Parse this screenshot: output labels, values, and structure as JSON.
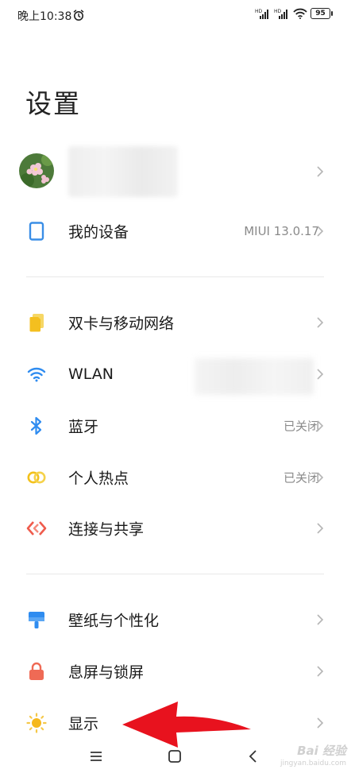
{
  "status_bar": {
    "time": "晚上10:38",
    "signal1": "HD",
    "signal2": "HD",
    "battery": "95"
  },
  "page": {
    "title": "设置"
  },
  "profile": {
    "name": ""
  },
  "items": {
    "my_device": {
      "label": "我的设备",
      "value": "MIUI 13.0.17",
      "icon": "tablet-icon",
      "color": "#3a8ee6"
    },
    "sim": {
      "label": "双卡与移动网络",
      "icon": "sim-card-icon",
      "color": "#f6c02a"
    },
    "wlan": {
      "label": "WLAN",
      "icon": "wifi-icon",
      "color": "#2f8cf0"
    },
    "bluetooth": {
      "label": "蓝牙",
      "value": "已关闭",
      "icon": "bluetooth-icon",
      "color": "#2f8cf0"
    },
    "hotspot": {
      "label": "个人热点",
      "value": "已关闭",
      "icon": "hotspot-icon",
      "color": "#f3c11b"
    },
    "connection": {
      "label": "连接与共享",
      "icon": "connection-icon",
      "color": "#ef5b4c"
    },
    "wallpaper": {
      "label": "壁纸与个性化",
      "icon": "wallpaper-icon",
      "color": "#2f8cf0"
    },
    "lockscreen": {
      "label": "息屏与锁屏",
      "icon": "lock-icon",
      "color": "#ef6a55"
    },
    "display": {
      "label": "显示",
      "icon": "sun-icon",
      "color": "#f5b81c"
    }
  },
  "nav": {
    "menu": "menu-icon",
    "home": "home-icon",
    "back": "back-icon"
  },
  "watermark": {
    "text": "Bai 经验",
    "sub": "jingyan.baidu.com"
  },
  "annotation": {
    "color": "#e8121e"
  }
}
